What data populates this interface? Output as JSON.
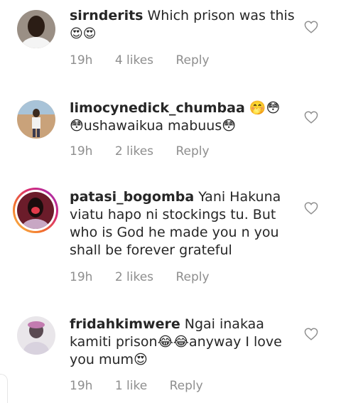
{
  "comments": [
    {
      "username": "sirnderits",
      "text": "Which prison was this",
      "emoji": "😍😍",
      "time": "19h",
      "likes": "4 likes",
      "reply": "Reply"
    },
    {
      "username": "limocynedick_chumbaa",
      "text": "🤭😳 😳ushawaikua mabuus😳",
      "time": "19h",
      "likes": "2 likes",
      "reply": "Reply"
    },
    {
      "username": "patasi_bogomba",
      "text": "Yani Hakuna viatu hapo ni stockings tu. But who is God he made you n you shall be forever grateful",
      "time": "19h",
      "likes": "2 likes",
      "reply": "Reply"
    },
    {
      "username": "fridahkimwere",
      "text": "Ngai inakaa kamiti prison😂😂anyway I love you mum😍",
      "time": "19h",
      "likes": "1 like",
      "reply": "Reply"
    }
  ],
  "icons": {
    "like": "heart-outline-icon"
  },
  "colors": {
    "meta": "#8e8e8e",
    "text": "#262626"
  }
}
